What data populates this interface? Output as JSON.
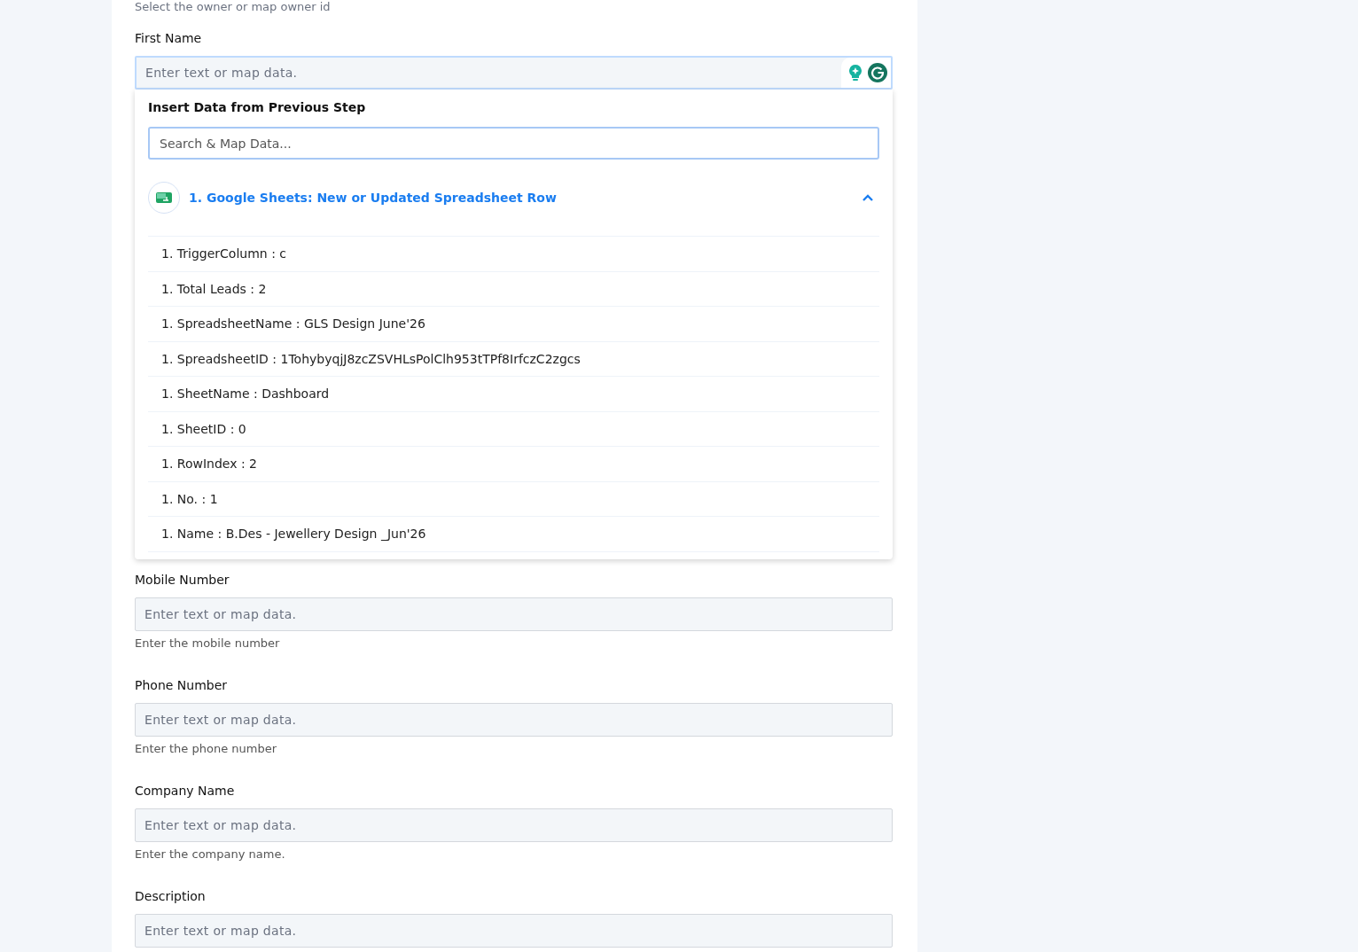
{
  "owner_hint": "Select the owner or map owner id",
  "first_name": {
    "label": "First Name",
    "placeholder": "Enter text or map data.",
    "focused": true
  },
  "dropdown": {
    "title": "Insert Data from Previous Step",
    "search_placeholder": "Search & Map Data...",
    "step": {
      "title": "1. Google Sheets: New or Updated Spreadsheet Row",
      "expanded": true,
      "items": [
        {
          "text": "1. TriggerColumn : c"
        },
        {
          "text": "1. Total Leads : 2"
        },
        {
          "text": "1. SpreadsheetName : GLS Design June'26"
        },
        {
          "text": "1. SpreadsheetID : 1TohybyqjJ8zcZSVHLsPolClh953tTPf8IrfczC2zgcs"
        },
        {
          "text": "1. SheetName : Dashboard"
        },
        {
          "text": "1. SheetID : 0"
        },
        {
          "text": "1. RowIndex : 2"
        },
        {
          "text": "1. No. : 1"
        },
        {
          "text": "1. Name : B.Des - Jewellery Design _Jun'26"
        }
      ]
    }
  },
  "fields": [
    {
      "label": "Mobile Number",
      "placeholder": "Enter text or map data.",
      "hint": "Enter the mobile number"
    },
    {
      "label": "Phone Number",
      "placeholder": "Enter text or map data.",
      "hint": "Enter the phone number"
    },
    {
      "label": "Company Name",
      "placeholder": "Enter text or map data.",
      "hint": "Enter the company name."
    },
    {
      "label": "Description",
      "placeholder": "Enter text or map data."
    }
  ]
}
